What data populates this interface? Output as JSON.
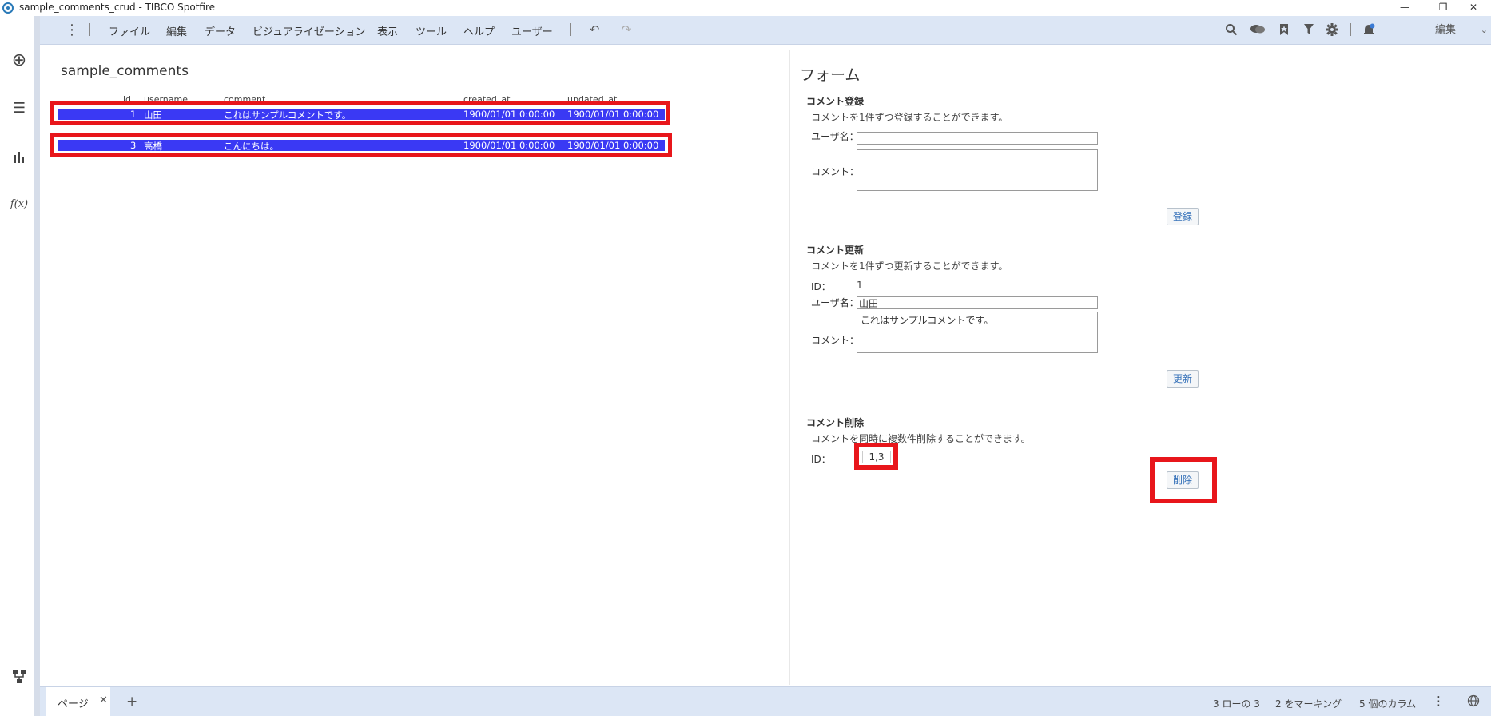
{
  "window": {
    "title": "sample_comments_crud - TIBCO Spotfire",
    "minimize_glyph": "—",
    "restore_glyph": "❐",
    "close_glyph": "✕"
  },
  "toolbar": {
    "menu_dots": "⋮",
    "menus": [
      "ファイル",
      "編集",
      "データ",
      "ビジュアライゼーション",
      "表示",
      "ツール",
      "ヘルプ",
      "ユーザー"
    ],
    "undo_icon": "↶",
    "redo_icon": "↷",
    "mode_label": "編集",
    "mode_chevron": "⌄",
    "right_icons": [
      "search-icon",
      "chat-icon",
      "bookmark-icon",
      "filter-icon",
      "gear-icon",
      "notification-icon"
    ]
  },
  "left_rail": {
    "add_icon": "⊕",
    "list_icon": "☰",
    "chart_icon": "▮",
    "fx_label": "f(x)",
    "tree_icon": "⛶"
  },
  "table": {
    "title": "sample_comments",
    "headers": [
      "id",
      "username",
      "comment",
      "created_at",
      "updated_at"
    ],
    "rows": [
      {
        "id": "1",
        "username": "山田",
        "comment": "これはサンプルコメントです。",
        "created_at": "1900/01/01 0:00:00",
        "updated_at": "1900/01/01 0:00:00"
      },
      {
        "id": "3",
        "username": "高橋",
        "comment": "こんにちは。",
        "created_at": "1900/01/01 0:00:00",
        "updated_at": "1900/01/01 0:00:00"
      }
    ]
  },
  "form": {
    "title": "フォーム",
    "register": {
      "title": "コメント登録",
      "description": "コメントを1件ずつ登録することができます。",
      "username_label": "ユーザ名：",
      "username_value": "",
      "comment_label": "コメント：",
      "comment_value": "",
      "button": "登録"
    },
    "update": {
      "title": "コメント更新",
      "description": "コメントを1件ずつ更新することができます。",
      "id_label": "ID：",
      "id_value": "1",
      "username_label": "ユーザ名：",
      "username_value": "山田",
      "comment_label": "コメント：",
      "comment_value": "これはサンプルコメントです。",
      "button": "更新"
    },
    "delete": {
      "title": "コメント削除",
      "description": "コメントを同時に複数件削除することができます。",
      "id_label": "ID：",
      "id_value": "1,3",
      "button": "削除"
    }
  },
  "statusbar": {
    "page_tab": "ページ",
    "close_glyph": "✕",
    "add_glyph": "+",
    "rows_text": "3 ローの 3",
    "marked_text": "2 をマーキング",
    "columns_text": "5 個のカラム",
    "more_glyph": "⋮",
    "globe_icon": "globe-icon"
  },
  "colors": {
    "toolbar_bg": "#dce6f5",
    "marked_row": "#3a39f4",
    "highlight": "#e8161b",
    "button_text": "#3470b8"
  }
}
